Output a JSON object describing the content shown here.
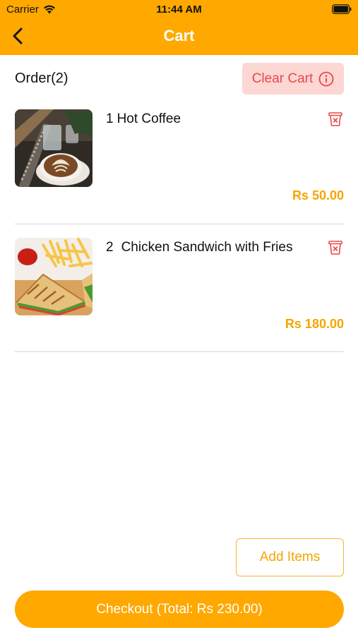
{
  "status_bar": {
    "carrier": "Carrier",
    "time": "11:44 AM"
  },
  "nav": {
    "title": "Cart",
    "back_icon": "chevron-left-icon"
  },
  "order": {
    "title": "Order(2)",
    "clear_cart_label": "Clear Cart"
  },
  "items": [
    {
      "qty": "1",
      "name": "Hot Coffee",
      "price": "Rs 50.00",
      "image": "latte-art-coffee-photo"
    },
    {
      "qty": "2",
      "name": "Chicken Sandwich with Fries",
      "price": "Rs 180.00",
      "image": "sandwich-fries-photo"
    }
  ],
  "actions": {
    "add_items_label": "Add Items",
    "checkout_label": "Checkout (Total: Rs 230.00)"
  },
  "colors": {
    "primary": "#FFA800",
    "price": "#F5A500",
    "danger": "#E8484A",
    "danger_bg": "#FCD7D4"
  }
}
